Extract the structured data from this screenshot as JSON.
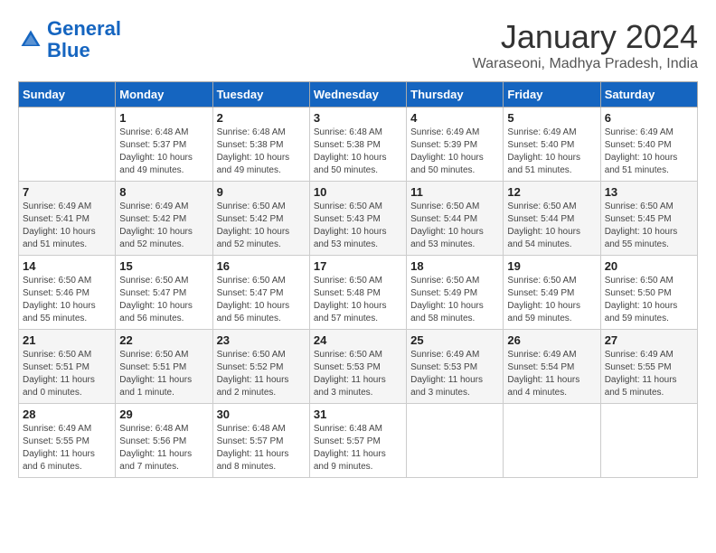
{
  "header": {
    "logo_line1": "General",
    "logo_line2": "Blue",
    "month_year": "January 2024",
    "location": "Waraseoni, Madhya Pradesh, India"
  },
  "weekdays": [
    "Sunday",
    "Monday",
    "Tuesday",
    "Wednesday",
    "Thursday",
    "Friday",
    "Saturday"
  ],
  "weeks": [
    [
      {
        "day": "",
        "sunrise": "",
        "sunset": "",
        "daylight": ""
      },
      {
        "day": "1",
        "sunrise": "Sunrise: 6:48 AM",
        "sunset": "Sunset: 5:37 PM",
        "daylight": "Daylight: 10 hours and 49 minutes."
      },
      {
        "day": "2",
        "sunrise": "Sunrise: 6:48 AM",
        "sunset": "Sunset: 5:38 PM",
        "daylight": "Daylight: 10 hours and 49 minutes."
      },
      {
        "day": "3",
        "sunrise": "Sunrise: 6:48 AM",
        "sunset": "Sunset: 5:38 PM",
        "daylight": "Daylight: 10 hours and 50 minutes."
      },
      {
        "day": "4",
        "sunrise": "Sunrise: 6:49 AM",
        "sunset": "Sunset: 5:39 PM",
        "daylight": "Daylight: 10 hours and 50 minutes."
      },
      {
        "day": "5",
        "sunrise": "Sunrise: 6:49 AM",
        "sunset": "Sunset: 5:40 PM",
        "daylight": "Daylight: 10 hours and 51 minutes."
      },
      {
        "day": "6",
        "sunrise": "Sunrise: 6:49 AM",
        "sunset": "Sunset: 5:40 PM",
        "daylight": "Daylight: 10 hours and 51 minutes."
      }
    ],
    [
      {
        "day": "7",
        "sunrise": "Sunrise: 6:49 AM",
        "sunset": "Sunset: 5:41 PM",
        "daylight": "Daylight: 10 hours and 51 minutes."
      },
      {
        "day": "8",
        "sunrise": "Sunrise: 6:49 AM",
        "sunset": "Sunset: 5:42 PM",
        "daylight": "Daylight: 10 hours and 52 minutes."
      },
      {
        "day": "9",
        "sunrise": "Sunrise: 6:50 AM",
        "sunset": "Sunset: 5:42 PM",
        "daylight": "Daylight: 10 hours and 52 minutes."
      },
      {
        "day": "10",
        "sunrise": "Sunrise: 6:50 AM",
        "sunset": "Sunset: 5:43 PM",
        "daylight": "Daylight: 10 hours and 53 minutes."
      },
      {
        "day": "11",
        "sunrise": "Sunrise: 6:50 AM",
        "sunset": "Sunset: 5:44 PM",
        "daylight": "Daylight: 10 hours and 53 minutes."
      },
      {
        "day": "12",
        "sunrise": "Sunrise: 6:50 AM",
        "sunset": "Sunset: 5:44 PM",
        "daylight": "Daylight: 10 hours and 54 minutes."
      },
      {
        "day": "13",
        "sunrise": "Sunrise: 6:50 AM",
        "sunset": "Sunset: 5:45 PM",
        "daylight": "Daylight: 10 hours and 55 minutes."
      }
    ],
    [
      {
        "day": "14",
        "sunrise": "Sunrise: 6:50 AM",
        "sunset": "Sunset: 5:46 PM",
        "daylight": "Daylight: 10 hours and 55 minutes."
      },
      {
        "day": "15",
        "sunrise": "Sunrise: 6:50 AM",
        "sunset": "Sunset: 5:47 PM",
        "daylight": "Daylight: 10 hours and 56 minutes."
      },
      {
        "day": "16",
        "sunrise": "Sunrise: 6:50 AM",
        "sunset": "Sunset: 5:47 PM",
        "daylight": "Daylight: 10 hours and 56 minutes."
      },
      {
        "day": "17",
        "sunrise": "Sunrise: 6:50 AM",
        "sunset": "Sunset: 5:48 PM",
        "daylight": "Daylight: 10 hours and 57 minutes."
      },
      {
        "day": "18",
        "sunrise": "Sunrise: 6:50 AM",
        "sunset": "Sunset: 5:49 PM",
        "daylight": "Daylight: 10 hours and 58 minutes."
      },
      {
        "day": "19",
        "sunrise": "Sunrise: 6:50 AM",
        "sunset": "Sunset: 5:49 PM",
        "daylight": "Daylight: 10 hours and 59 minutes."
      },
      {
        "day": "20",
        "sunrise": "Sunrise: 6:50 AM",
        "sunset": "Sunset: 5:50 PM",
        "daylight": "Daylight: 10 hours and 59 minutes."
      }
    ],
    [
      {
        "day": "21",
        "sunrise": "Sunrise: 6:50 AM",
        "sunset": "Sunset: 5:51 PM",
        "daylight": "Daylight: 11 hours and 0 minutes."
      },
      {
        "day": "22",
        "sunrise": "Sunrise: 6:50 AM",
        "sunset": "Sunset: 5:51 PM",
        "daylight": "Daylight: 11 hours and 1 minute."
      },
      {
        "day": "23",
        "sunrise": "Sunrise: 6:50 AM",
        "sunset": "Sunset: 5:52 PM",
        "daylight": "Daylight: 11 hours and 2 minutes."
      },
      {
        "day": "24",
        "sunrise": "Sunrise: 6:50 AM",
        "sunset": "Sunset: 5:53 PM",
        "daylight": "Daylight: 11 hours and 3 minutes."
      },
      {
        "day": "25",
        "sunrise": "Sunrise: 6:49 AM",
        "sunset": "Sunset: 5:53 PM",
        "daylight": "Daylight: 11 hours and 3 minutes."
      },
      {
        "day": "26",
        "sunrise": "Sunrise: 6:49 AM",
        "sunset": "Sunset: 5:54 PM",
        "daylight": "Daylight: 11 hours and 4 minutes."
      },
      {
        "day": "27",
        "sunrise": "Sunrise: 6:49 AM",
        "sunset": "Sunset: 5:55 PM",
        "daylight": "Daylight: 11 hours and 5 minutes."
      }
    ],
    [
      {
        "day": "28",
        "sunrise": "Sunrise: 6:49 AM",
        "sunset": "Sunset: 5:55 PM",
        "daylight": "Daylight: 11 hours and 6 minutes."
      },
      {
        "day": "29",
        "sunrise": "Sunrise: 6:48 AM",
        "sunset": "Sunset: 5:56 PM",
        "daylight": "Daylight: 11 hours and 7 minutes."
      },
      {
        "day": "30",
        "sunrise": "Sunrise: 6:48 AM",
        "sunset": "Sunset: 5:57 PM",
        "daylight": "Daylight: 11 hours and 8 minutes."
      },
      {
        "day": "31",
        "sunrise": "Sunrise: 6:48 AM",
        "sunset": "Sunset: 5:57 PM",
        "daylight": "Daylight: 11 hours and 9 minutes."
      },
      {
        "day": "",
        "sunrise": "",
        "sunset": "",
        "daylight": ""
      },
      {
        "day": "",
        "sunrise": "",
        "sunset": "",
        "daylight": ""
      },
      {
        "day": "",
        "sunrise": "",
        "sunset": "",
        "daylight": ""
      }
    ]
  ]
}
